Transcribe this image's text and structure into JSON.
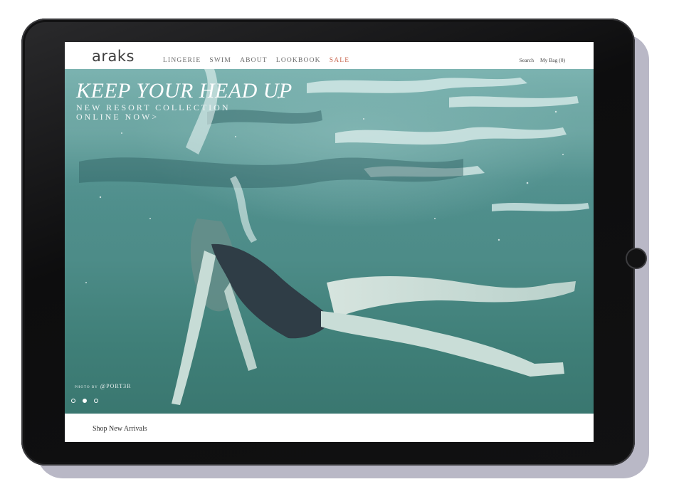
{
  "brand": {
    "logo_text": "araks"
  },
  "nav": {
    "links": [
      "LINGERIE",
      "SWIM",
      "ABOUT",
      "LOOKBOOK",
      "SALE"
    ],
    "search_label": "Search",
    "bag_label": "My Bag (0)",
    "sale_color": "#c8664f"
  },
  "hero": {
    "title": "KEEP YOUR HEAD UP",
    "subtitle_line1": "NEW RESORT COLLECTION",
    "subtitle_line2": "ONLINE NOW>",
    "photo_credit_prefix": "PHOTO BY",
    "photo_credit_handle": "@PORT3R",
    "carousel": {
      "slides": 3,
      "active_index": 1
    }
  },
  "footer": {
    "shop_new_label": "Shop New Arrivals"
  },
  "colors": {
    "device_frame": "#111112",
    "water": "#4d8c88",
    "text_dark": "#333333"
  },
  "icons": {
    "home_button": "home-button-icon"
  }
}
